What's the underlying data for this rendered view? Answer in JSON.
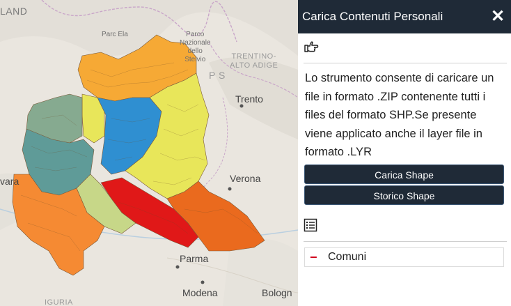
{
  "map": {
    "labels": {
      "land": "LAND",
      "parco_elsa": "Parc Ela",
      "parco_stelvio": "Parco\nNazionale\ndello\nStelvio",
      "trentino": "TRENTINO-\nALTO ADIGE",
      "ps": "P S",
      "trento": "Trento",
      "verona": "Verona",
      "novara": "vara",
      "parma": "Parma",
      "modena": "Modena",
      "bologna": "Bologn",
      "liguria": "IGURIA"
    },
    "colors": {
      "background": "#eae6df",
      "orange": "#f58a33",
      "gold": "#f6a935",
      "yellow": "#e8e65a",
      "blue": "#2f8fd1",
      "teal": "#5f9b98",
      "sage": "#86aa90",
      "olive": "#c7d788",
      "red": "#e01818",
      "darkorange": "#ea6a1e"
    }
  },
  "panel": {
    "title": "Carica Contenuti Personali",
    "close_glyph": "✕",
    "hand_icon": "pointing-hand-icon",
    "description": "Lo strumento consente di caricare un file in formato .ZIP contenente tutti i files del formato SHP.Se presente viene applicato anche il layer file in formato .LYR",
    "buttons": {
      "carica": "Carica Shape",
      "storico": "Storico Shape"
    },
    "list_icon": "list-icon",
    "layers": [
      {
        "label": "Comuni",
        "remove_glyph": "−"
      }
    ]
  }
}
